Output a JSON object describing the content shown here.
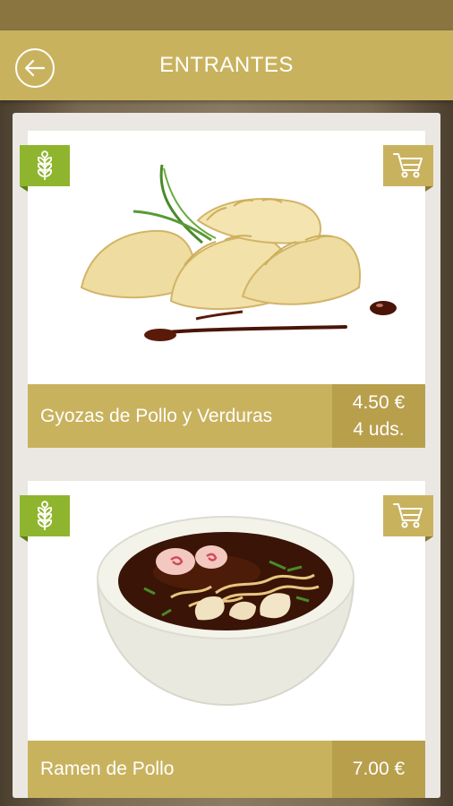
{
  "header": {
    "title": "ENTRANTES",
    "back_icon": "arrow-left-icon",
    "accent": "#c9b25e"
  },
  "items": [
    {
      "name": "Gyozas de Pollo y Verduras",
      "price": "4.50 €",
      "units": "4 uds.",
      "image": "gyoza-dumplings-image",
      "badge_icon": "wheat-icon",
      "cart_icon": "cart-icon"
    },
    {
      "name": "Ramen de Pollo",
      "price": "7.00 €",
      "image": "ramen-bowl-image",
      "badge_icon": "wheat-icon",
      "cart_icon": "cart-icon"
    }
  ],
  "colors": {
    "gold": "#c9b25e",
    "gold_dark": "#b89f4c",
    "green_badge": "#8fb52e",
    "panel": "#ebe8e3"
  }
}
